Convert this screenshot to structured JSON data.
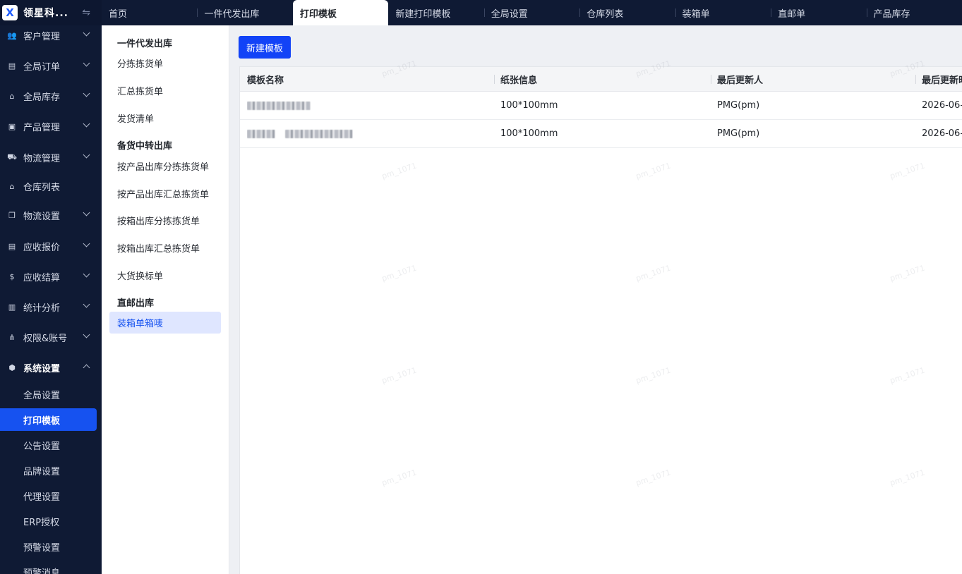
{
  "brand": {
    "name": "领星科...",
    "logo_letter": "X"
  },
  "sidebar": {
    "items": [
      {
        "label": "客户管理",
        "icon": "users-icon",
        "glyph": "👥",
        "expanded": false
      },
      {
        "label": "全局订单",
        "icon": "clipboard-icon",
        "glyph": "▤",
        "expanded": false
      },
      {
        "label": "全局库存",
        "icon": "warehouse-icon",
        "glyph": "⌂",
        "expanded": false
      },
      {
        "label": "产品管理",
        "icon": "box-icon",
        "glyph": "▣",
        "expanded": false
      },
      {
        "label": "物流管理",
        "icon": "truck-icon",
        "glyph": "⛟",
        "expanded": false
      },
      {
        "label": "仓库列表",
        "icon": "store-icon",
        "glyph": "⌂",
        "expanded": null
      },
      {
        "label": "物流设置",
        "icon": "cubes-icon",
        "glyph": "❒",
        "expanded": false
      },
      {
        "label": "应收报价",
        "icon": "document-icon",
        "glyph": "▤",
        "expanded": false
      },
      {
        "label": "应收结算",
        "icon": "coin-icon",
        "glyph": "$",
        "expanded": false
      },
      {
        "label": "统计分析",
        "icon": "chart-icon",
        "glyph": "▥",
        "expanded": false
      },
      {
        "label": "权限&账号",
        "icon": "org-icon",
        "glyph": "⋔",
        "expanded": false
      },
      {
        "label": "系统设置",
        "icon": "settings-hex-icon",
        "glyph": "⬢",
        "expanded": true
      }
    ],
    "sub_items": [
      {
        "label": "全局设置",
        "selected": false
      },
      {
        "label": "打印模板",
        "selected": true
      },
      {
        "label": "公告设置",
        "selected": false
      },
      {
        "label": "品牌设置",
        "selected": false
      },
      {
        "label": "代理设置",
        "selected": false
      },
      {
        "label": "ERP授权",
        "selected": false
      },
      {
        "label": "预警设置",
        "selected": false
      },
      {
        "label": "预警消息",
        "selected": false
      }
    ]
  },
  "tabs": [
    {
      "label": "首页",
      "active": false
    },
    {
      "label": "一件代发出库",
      "active": false
    },
    {
      "label": "打印模板",
      "active": true
    },
    {
      "label": "新建打印模板",
      "active": false
    },
    {
      "label": "全局设置",
      "active": false
    },
    {
      "label": "仓库列表",
      "active": false
    },
    {
      "label": "装箱单",
      "active": false
    },
    {
      "label": "直邮单",
      "active": false
    },
    {
      "label": "产品库存",
      "active": false
    }
  ],
  "subnav": {
    "groups": [
      {
        "title": "一件代发出库",
        "items": [
          "分拣拣货单",
          "汇总拣货单",
          "发货清单"
        ]
      },
      {
        "title": "备货中转出库",
        "items": [
          "按产品出库分拣拣货单",
          "按产品出库汇总拣货单",
          "按箱出库分拣拣货单",
          "按箱出库汇总拣货单",
          "大货换标单"
        ]
      },
      {
        "title": "直邮出库",
        "items": [
          "装箱单箱唛"
        ]
      }
    ],
    "selected": "装箱单箱唛"
  },
  "main": {
    "new_button": "新建模板",
    "table": {
      "columns": [
        "模板名称",
        "纸张信息",
        "最后更新人",
        "最后更新时"
      ],
      "rows": [
        {
          "name": "",
          "paper": "100*100mm",
          "updater": "PMG(pm)",
          "updated": "2026-06-"
        },
        {
          "name": "",
          "paper": "100*100mm",
          "updater": "PMG(pm)",
          "updated": "2026-06-"
        }
      ]
    }
  },
  "watermark": {
    "text": "pm_1071",
    "color": "#969ba5"
  },
  "colors": {
    "sidebar_bg": "#0f1a34",
    "primary": "#1243f7",
    "selected_sub_bg": "#dfe6ff"
  }
}
